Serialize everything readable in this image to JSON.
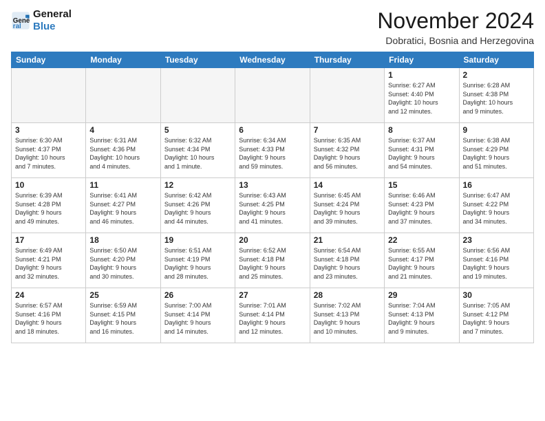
{
  "logo": {
    "line1": "General",
    "line2": "Blue"
  },
  "title": "November 2024",
  "location": "Dobratici, Bosnia and Herzegovina",
  "days": [
    "Sunday",
    "Monday",
    "Tuesday",
    "Wednesday",
    "Thursday",
    "Friday",
    "Saturday"
  ],
  "weeks": [
    [
      {
        "day": "",
        "info": ""
      },
      {
        "day": "",
        "info": ""
      },
      {
        "day": "",
        "info": ""
      },
      {
        "day": "",
        "info": ""
      },
      {
        "day": "",
        "info": ""
      },
      {
        "day": "1",
        "info": "Sunrise: 6:27 AM\nSunset: 4:40 PM\nDaylight: 10 hours\nand 12 minutes."
      },
      {
        "day": "2",
        "info": "Sunrise: 6:28 AM\nSunset: 4:38 PM\nDaylight: 10 hours\nand 9 minutes."
      }
    ],
    [
      {
        "day": "3",
        "info": "Sunrise: 6:30 AM\nSunset: 4:37 PM\nDaylight: 10 hours\nand 7 minutes."
      },
      {
        "day": "4",
        "info": "Sunrise: 6:31 AM\nSunset: 4:36 PM\nDaylight: 10 hours\nand 4 minutes."
      },
      {
        "day": "5",
        "info": "Sunrise: 6:32 AM\nSunset: 4:34 PM\nDaylight: 10 hours\nand 1 minute."
      },
      {
        "day": "6",
        "info": "Sunrise: 6:34 AM\nSunset: 4:33 PM\nDaylight: 9 hours\nand 59 minutes."
      },
      {
        "day": "7",
        "info": "Sunrise: 6:35 AM\nSunset: 4:32 PM\nDaylight: 9 hours\nand 56 minutes."
      },
      {
        "day": "8",
        "info": "Sunrise: 6:37 AM\nSunset: 4:31 PM\nDaylight: 9 hours\nand 54 minutes."
      },
      {
        "day": "9",
        "info": "Sunrise: 6:38 AM\nSunset: 4:29 PM\nDaylight: 9 hours\nand 51 minutes."
      }
    ],
    [
      {
        "day": "10",
        "info": "Sunrise: 6:39 AM\nSunset: 4:28 PM\nDaylight: 9 hours\nand 49 minutes."
      },
      {
        "day": "11",
        "info": "Sunrise: 6:41 AM\nSunset: 4:27 PM\nDaylight: 9 hours\nand 46 minutes."
      },
      {
        "day": "12",
        "info": "Sunrise: 6:42 AM\nSunset: 4:26 PM\nDaylight: 9 hours\nand 44 minutes."
      },
      {
        "day": "13",
        "info": "Sunrise: 6:43 AM\nSunset: 4:25 PM\nDaylight: 9 hours\nand 41 minutes."
      },
      {
        "day": "14",
        "info": "Sunrise: 6:45 AM\nSunset: 4:24 PM\nDaylight: 9 hours\nand 39 minutes."
      },
      {
        "day": "15",
        "info": "Sunrise: 6:46 AM\nSunset: 4:23 PM\nDaylight: 9 hours\nand 37 minutes."
      },
      {
        "day": "16",
        "info": "Sunrise: 6:47 AM\nSunset: 4:22 PM\nDaylight: 9 hours\nand 34 minutes."
      }
    ],
    [
      {
        "day": "17",
        "info": "Sunrise: 6:49 AM\nSunset: 4:21 PM\nDaylight: 9 hours\nand 32 minutes."
      },
      {
        "day": "18",
        "info": "Sunrise: 6:50 AM\nSunset: 4:20 PM\nDaylight: 9 hours\nand 30 minutes."
      },
      {
        "day": "19",
        "info": "Sunrise: 6:51 AM\nSunset: 4:19 PM\nDaylight: 9 hours\nand 28 minutes."
      },
      {
        "day": "20",
        "info": "Sunrise: 6:52 AM\nSunset: 4:18 PM\nDaylight: 9 hours\nand 25 minutes."
      },
      {
        "day": "21",
        "info": "Sunrise: 6:54 AM\nSunset: 4:18 PM\nDaylight: 9 hours\nand 23 minutes."
      },
      {
        "day": "22",
        "info": "Sunrise: 6:55 AM\nSunset: 4:17 PM\nDaylight: 9 hours\nand 21 minutes."
      },
      {
        "day": "23",
        "info": "Sunrise: 6:56 AM\nSunset: 4:16 PM\nDaylight: 9 hours\nand 19 minutes."
      }
    ],
    [
      {
        "day": "24",
        "info": "Sunrise: 6:57 AM\nSunset: 4:16 PM\nDaylight: 9 hours\nand 18 minutes."
      },
      {
        "day": "25",
        "info": "Sunrise: 6:59 AM\nSunset: 4:15 PM\nDaylight: 9 hours\nand 16 minutes."
      },
      {
        "day": "26",
        "info": "Sunrise: 7:00 AM\nSunset: 4:14 PM\nDaylight: 9 hours\nand 14 minutes."
      },
      {
        "day": "27",
        "info": "Sunrise: 7:01 AM\nSunset: 4:14 PM\nDaylight: 9 hours\nand 12 minutes."
      },
      {
        "day": "28",
        "info": "Sunrise: 7:02 AM\nSunset: 4:13 PM\nDaylight: 9 hours\nand 10 minutes."
      },
      {
        "day": "29",
        "info": "Sunrise: 7:04 AM\nSunset: 4:13 PM\nDaylight: 9 hours\nand 9 minutes."
      },
      {
        "day": "30",
        "info": "Sunrise: 7:05 AM\nSunset: 4:12 PM\nDaylight: 9 hours\nand 7 minutes."
      }
    ]
  ]
}
